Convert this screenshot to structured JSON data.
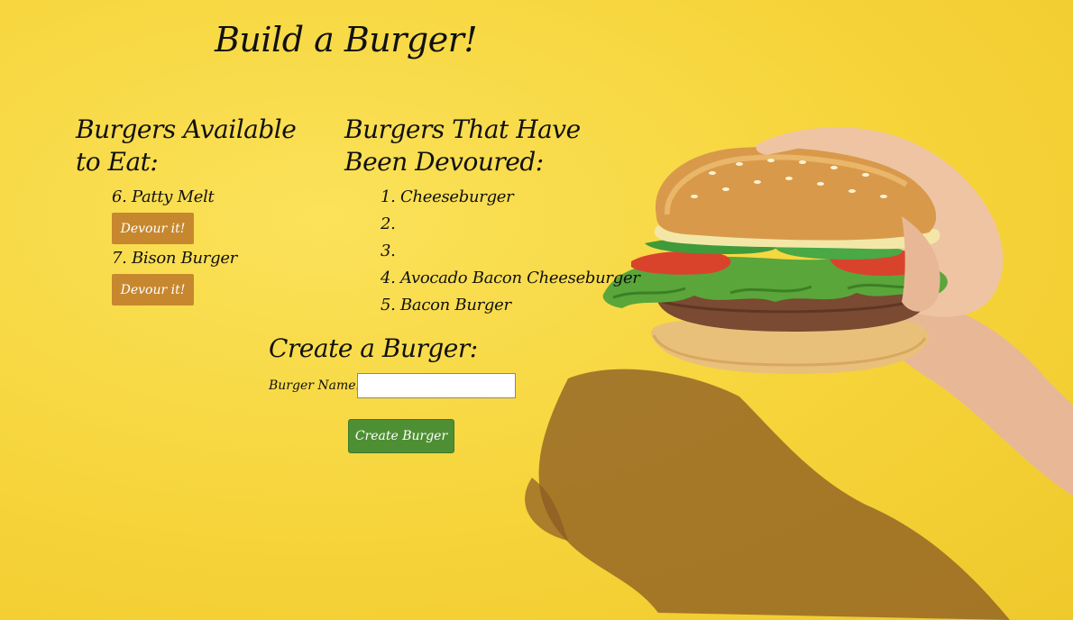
{
  "page": {
    "title": "Build a Burger!"
  },
  "available": {
    "heading_line1": "Burgers Available",
    "heading_line2": "to Eat:",
    "items": [
      {
        "label": "6. Patty Melt",
        "button": "Devour it!"
      },
      {
        "label": "7. Bison Burger",
        "button": "Devour it!"
      }
    ]
  },
  "devoured": {
    "heading_line1": "Burgers That Have",
    "heading_line2": "Been Devoured:",
    "items": [
      "1. Cheeseburger",
      "2.",
      "3.",
      "4. Avocado Bacon Cheeseburger",
      "5. Bacon Burger"
    ]
  },
  "create": {
    "heading": "Create a Burger:",
    "name_label": "Burger Name:",
    "name_value": "",
    "name_placeholder": "",
    "submit_label": "Create Burger"
  },
  "colors": {
    "background": "#f7d73a",
    "devour_button": "#c6872e",
    "create_button": "#4f8f33"
  },
  "images": {
    "hero": "burger-in-hand-illustration"
  }
}
